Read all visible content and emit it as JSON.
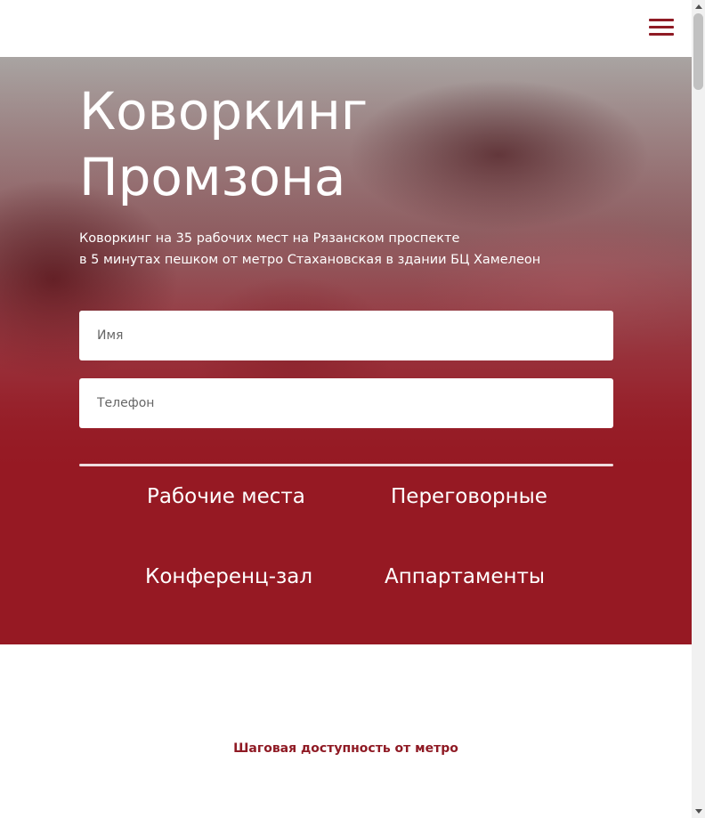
{
  "header": {
    "menu_icon": "hamburger-menu-icon"
  },
  "hero": {
    "title_line1": "Коворкинг",
    "title_line2": "Промзона",
    "subtitle_line1": "Коворкинг на 35 рабочих мест на Рязанском проспекте",
    "subtitle_line2": "в 5 минутах пешком от метро Стахановская в здании БЦ Хамелеон",
    "form": {
      "name_placeholder": "Имя",
      "phone_placeholder": "Телефон"
    },
    "links": {
      "workspaces": "Рабочие места",
      "meeting_rooms": "Переговорные",
      "conference_hall": "Конференц-зал",
      "apartments": "Аппартаменты"
    }
  },
  "section": {
    "heading": "Шаговая доступность от метро"
  },
  "colors": {
    "accent": "#8f1a24",
    "hero_red": "#961923"
  }
}
